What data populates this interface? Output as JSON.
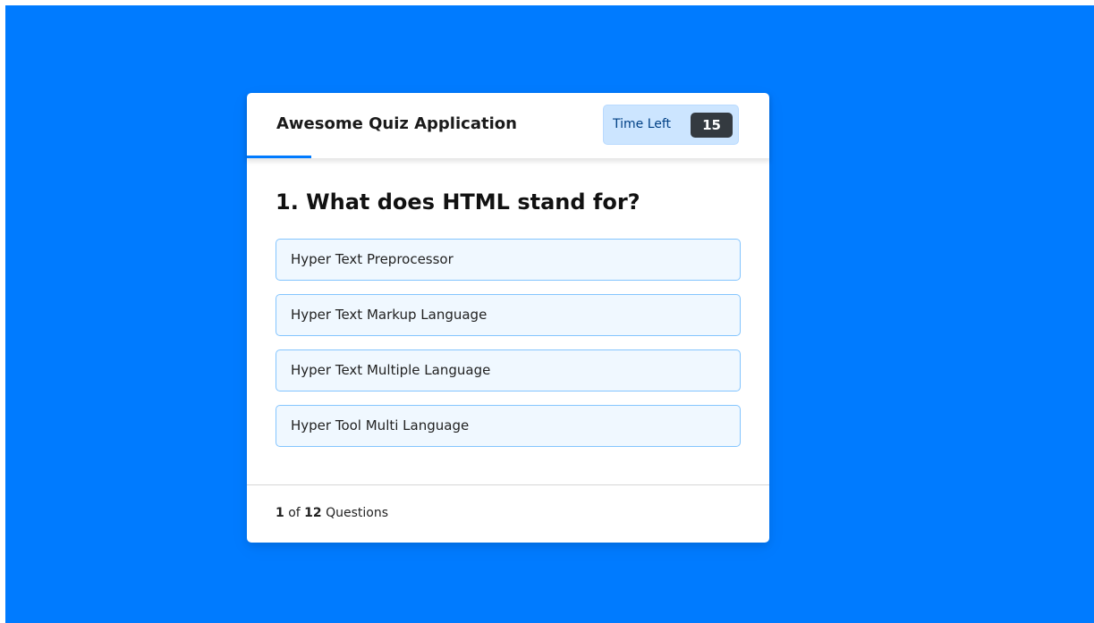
{
  "app": {
    "title": "Awesome Quiz Application"
  },
  "timer": {
    "label": "Time Left",
    "seconds": "15"
  },
  "question": {
    "text": "1. What does HTML stand for?",
    "options": [
      "Hyper Text Preprocessor",
      "Hyper Text Markup Language",
      "Hyper Text Multiple Language",
      "Hyper Tool Multi Language"
    ]
  },
  "footer": {
    "current": "1",
    "of_text": "of",
    "total": "12",
    "suffix": "Questions"
  },
  "colors": {
    "background": "#007bff",
    "card": "#ffffff",
    "timer_bg": "#cce5ff",
    "timer_sec_bg": "#343a40",
    "option_bg": "#f0f8ff",
    "option_border": "#84c5fe",
    "time_line": "#007bff"
  }
}
